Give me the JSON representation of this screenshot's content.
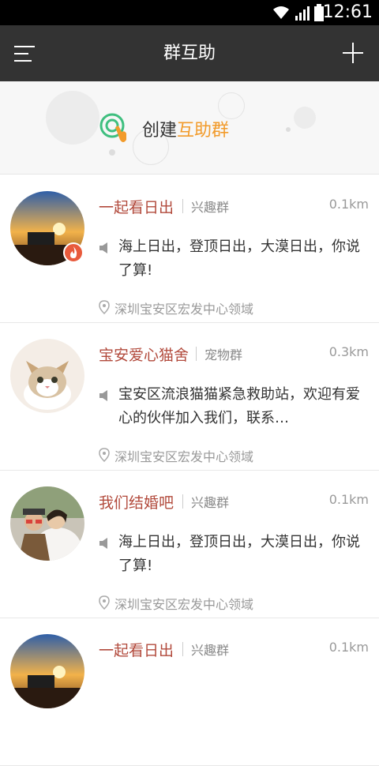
{
  "status": {
    "time": "12:61"
  },
  "app_bar": {
    "title": "群互助"
  },
  "banner": {
    "create_prefix": "创建",
    "create_highlight": "互助群"
  },
  "groups": [
    {
      "name": "一起看日出",
      "type": "兴趣群",
      "distance": "0.1km",
      "desc": "海上日出，登顶日出，大漠日出，你说了算!",
      "location": "深圳宝安区宏发中心领域",
      "hot": true,
      "avatar": "sunrise"
    },
    {
      "name": "宝安爱心猫舍",
      "type": "宠物群",
      "distance": "0.3km",
      "desc": "宝安区流浪猫猫紧急救助站，欢迎有爱心的伙伴加入我们，联系…",
      "location": "深圳宝安区宏发中心领域",
      "hot": false,
      "avatar": "cat"
    },
    {
      "name": "我们结婚吧",
      "type": "兴趣群",
      "distance": "0.1km",
      "desc": "海上日出，登顶日出，大漠日出，你说了算!",
      "location": "深圳宝安区宏发中心领域",
      "hot": false,
      "avatar": "couple"
    },
    {
      "name": "一起看日出",
      "type": "兴趣群",
      "distance": "0.1km",
      "desc": "",
      "location": "",
      "hot": false,
      "avatar": "sunrise"
    }
  ],
  "colors": {
    "app_bar": "#333333",
    "group_name": "#b24a3c",
    "highlight": "#f29b2b",
    "hot_badge": "#e85a3c"
  }
}
